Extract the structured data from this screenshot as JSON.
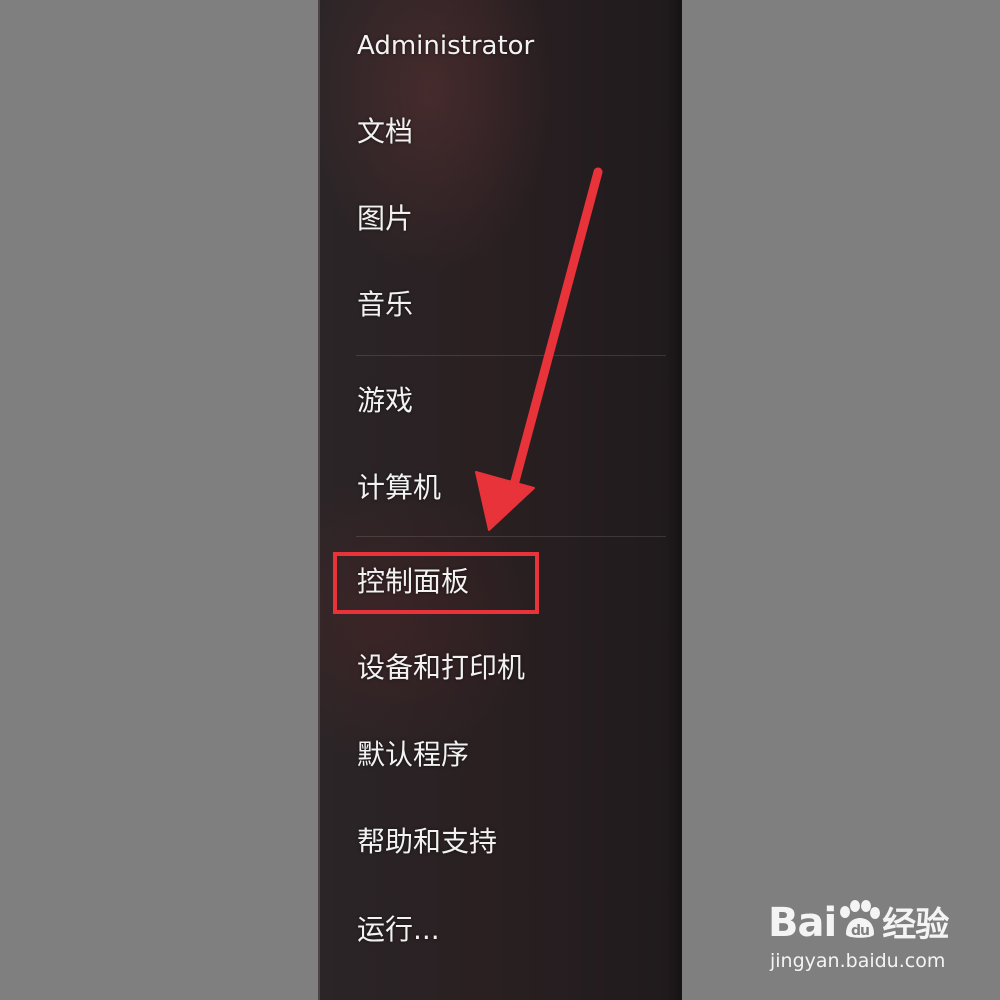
{
  "start_menu": {
    "items": [
      {
        "label": "Administrator"
      },
      {
        "label": "文档"
      },
      {
        "label": "图片"
      },
      {
        "label": "音乐"
      },
      {
        "label": "游戏"
      },
      {
        "label": "计算机"
      },
      {
        "label": "控制面板"
      },
      {
        "label": "设备和打印机"
      },
      {
        "label": "默认程序"
      },
      {
        "label": "帮助和支持"
      },
      {
        "label": "运行..."
      }
    ]
  },
  "annotation": {
    "highlight_color": "#e8333a",
    "arrow_color": "#e8333a",
    "highlighted_item": "控制面板"
  },
  "watermark": {
    "logo_text": "Bai",
    "logo_text_2": "经验",
    "site": "jingyan.baidu.com",
    "icon": "paw-icon"
  }
}
